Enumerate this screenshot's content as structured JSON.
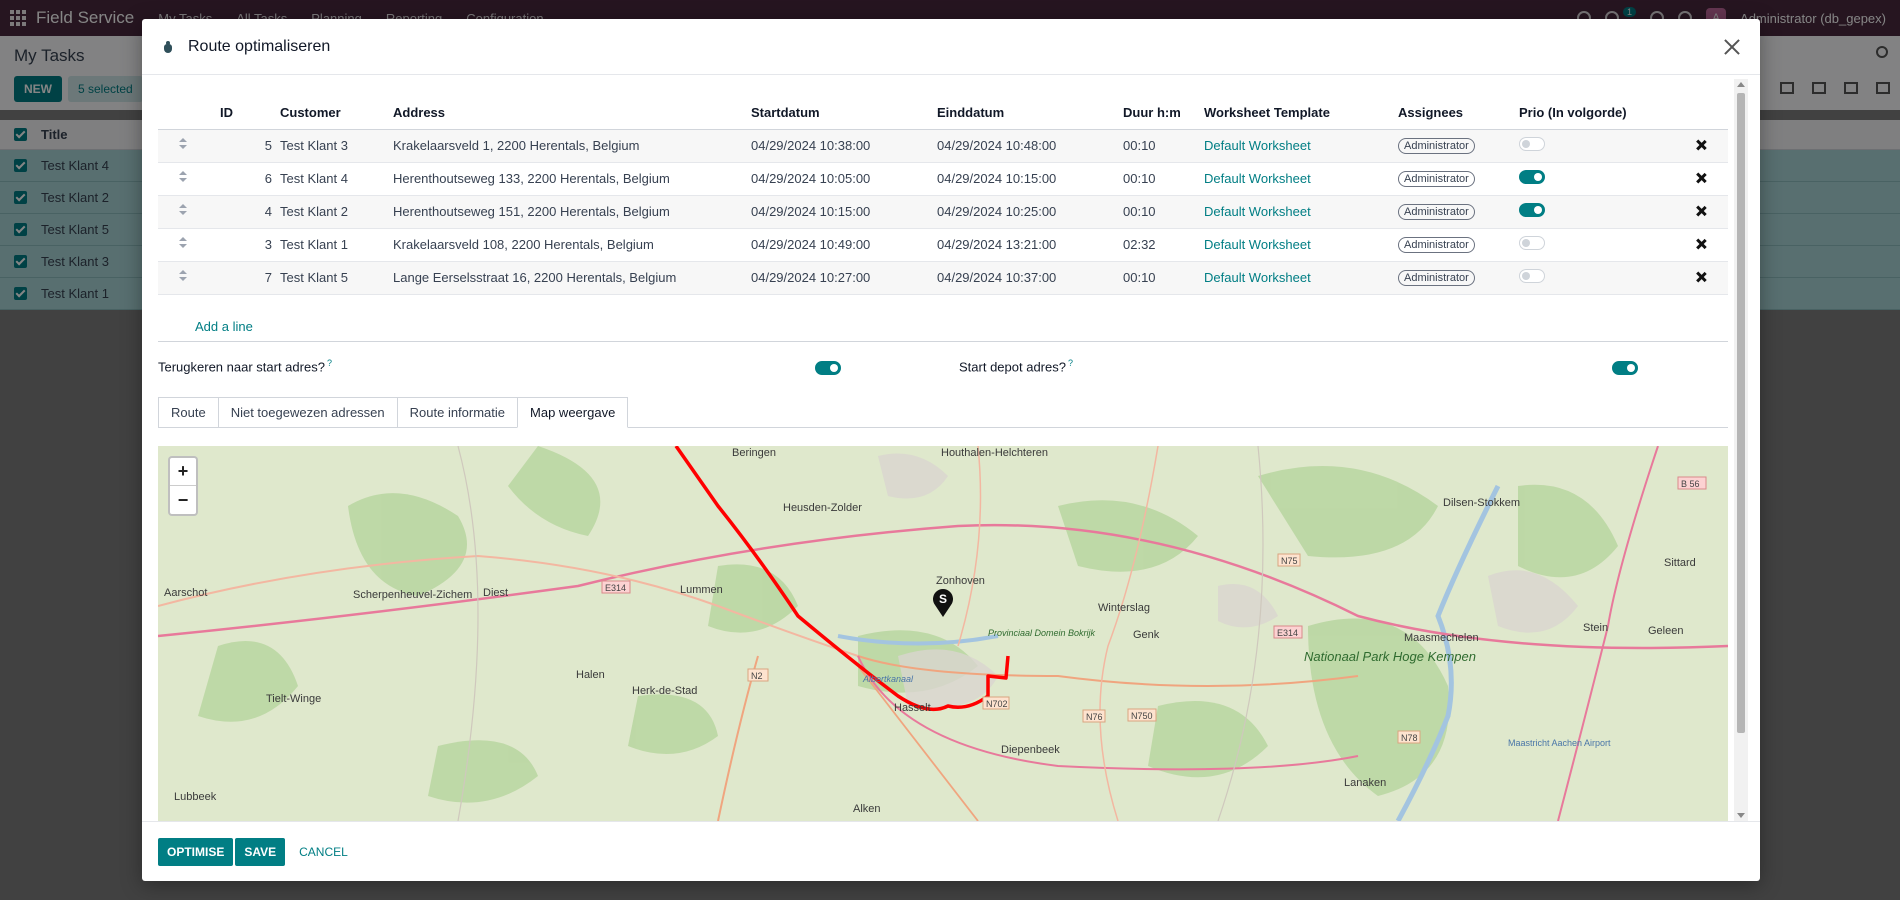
{
  "app": {
    "brand": "Field Service",
    "menu": [
      "My Tasks",
      "All Tasks",
      "Planning",
      "Reporting",
      "Configuration"
    ],
    "user": "Administrator (db_gepex)",
    "avatar_letter": "A",
    "chat_badge": "1"
  },
  "background": {
    "page_title": "My Tasks",
    "new_label": "NEW",
    "selected_label": "5 selected",
    "column_title": "Title",
    "rows": [
      "Test Klant 4",
      "Test Klant 2",
      "Test Klant 5",
      "Test Klant 3",
      "Test Klant 1"
    ]
  },
  "dialog": {
    "title": "Route optimaliseren",
    "columns": {
      "id": "ID",
      "customer": "Customer",
      "address": "Address",
      "start": "Startdatum",
      "end": "Einddatum",
      "duration": "Duur h:m",
      "worksheet": "Worksheet Template",
      "assignees": "Assignees",
      "prio": "Prio (In volgorde)"
    },
    "rows": [
      {
        "id": "5",
        "customer": "Test Klant 3",
        "address": "Krakelaarsveld 1, 2200 Herentals, Belgium",
        "start": "04/29/2024 10:38:00",
        "end": "04/29/2024 10:48:00",
        "duration": "00:10",
        "worksheet": "Default Worksheet",
        "assignee": "Administrator",
        "prio": false
      },
      {
        "id": "6",
        "customer": "Test Klant 4",
        "address": "Herenthoutseweg 133, 2200 Herentals, Belgium",
        "start": "04/29/2024 10:05:00",
        "end": "04/29/2024 10:15:00",
        "duration": "00:10",
        "worksheet": "Default Worksheet",
        "assignee": "Administrator",
        "prio": true
      },
      {
        "id": "4",
        "customer": "Test Klant 2",
        "address": "Herenthoutseweg 151, 2200 Herentals, Belgium",
        "start": "04/29/2024 10:15:00",
        "end": "04/29/2024 10:25:00",
        "duration": "00:10",
        "worksheet": "Default Worksheet",
        "assignee": "Administrator",
        "prio": true
      },
      {
        "id": "3",
        "customer": "Test Klant 1",
        "address": "Krakelaarsveld 108, 2200 Herentals, Belgium",
        "start": "04/29/2024 10:49:00",
        "end": "04/29/2024 13:21:00",
        "duration": "02:32",
        "worksheet": "Default Worksheet",
        "assignee": "Administrator",
        "prio": false
      },
      {
        "id": "7",
        "customer": "Test Klant 5",
        "address": "Lange Eerselsstraat 16, 2200 Herentals, Belgium",
        "start": "04/29/2024 10:27:00",
        "end": "04/29/2024 10:37:00",
        "duration": "00:10",
        "worksheet": "Default Worksheet",
        "assignee": "Administrator",
        "prio": false
      }
    ],
    "add_line": "Add a line",
    "return_to_start": {
      "label": "Terugkeren naar start adres?",
      "help": "?",
      "value": true
    },
    "start_depot": {
      "label": "Start depot adres?",
      "help": "?",
      "value": true
    },
    "tabs": [
      "Route",
      "Niet toegewezen adressen",
      "Route informatie",
      "Map weergave"
    ],
    "active_tab": "Map weergave",
    "map": {
      "zoom_in": "+",
      "zoom_out": "−",
      "start_marker": "S",
      "route_color": "#ff0000",
      "places": [
        "Beringen",
        "Houthalen-Helchteren",
        "Heusden-Zolder",
        "Aarschot",
        "Scherpenheuvel-Zichem",
        "Diest",
        "Lummen",
        "Zonhoven",
        "Winterslag",
        "Genk",
        "Maasmechelen",
        "Dilsen-Stokkem",
        "Sittard",
        "Stein",
        "Geleen",
        "Halen",
        "Herk-de-Stad",
        "Hasselt",
        "Diepenbeek",
        "Tielt-Winge",
        "Lubbeek",
        "Alken",
        "Lanaken",
        "Nationaal Park Hoge Kempen",
        "Provinciaal Domein Bokrijk",
        "Albertkanaal",
        "Maastricht Aachen Airport"
      ],
      "road_labels": [
        "E314",
        "N2",
        "N702",
        "N76",
        "N750",
        "N75",
        "N78",
        "E314",
        "B 56"
      ]
    },
    "buttons": {
      "optimise": "OPTIMISE",
      "save": "SAVE",
      "cancel": "CANCEL"
    }
  }
}
